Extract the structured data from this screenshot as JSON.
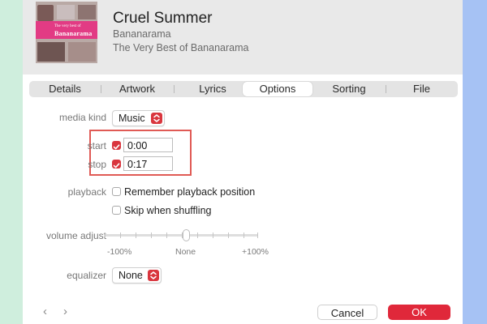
{
  "song": {
    "title": "Cruel Summer",
    "artist": "Bananarama",
    "album": "The Very Best of Bananarama",
    "artwork_line1": "The very best of",
    "artwork_line2": "Bananarama"
  },
  "tabs": [
    {
      "label": "Details",
      "selected": false
    },
    {
      "label": "Artwork",
      "selected": false
    },
    {
      "label": "Lyrics",
      "selected": false
    },
    {
      "label": "Options",
      "selected": true
    },
    {
      "label": "Sorting",
      "selected": false
    },
    {
      "label": "File",
      "selected": false
    }
  ],
  "options": {
    "media_kind_label": "media kind",
    "media_kind_value": "Music",
    "start_label": "start",
    "start_checked": true,
    "start_value": "0:00",
    "stop_label": "stop",
    "stop_checked": true,
    "stop_value": "0:17",
    "playback_label": "playback",
    "remember_label": "Remember playback position",
    "remember_checked": false,
    "skip_label": "Skip when shuffling",
    "skip_checked": false,
    "volume_label": "volume adjust",
    "volume_min": "-100%",
    "volume_mid": "None",
    "volume_max": "+100%",
    "volume_value_percent": 0,
    "equalizer_label": "equalizer",
    "equalizer_value": "None"
  },
  "footer": {
    "prev_glyph": "‹",
    "next_glyph": "›",
    "cancel_label": "Cancel",
    "ok_label": "OK"
  },
  "colors": {
    "accent": "#d9363e",
    "ok_button": "#e0283a",
    "highlight_box": "#e05a55"
  }
}
